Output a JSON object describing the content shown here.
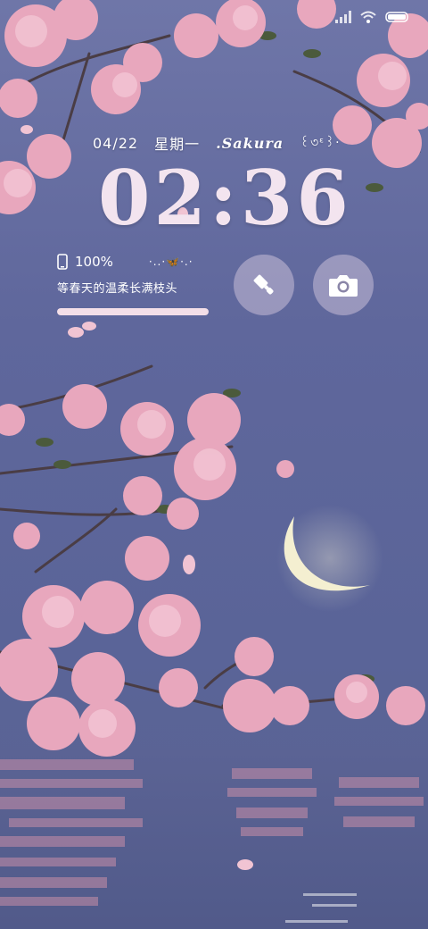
{
  "status_bar": {
    "icons": [
      "signal-icon",
      "wifi-icon",
      "battery-icon"
    ]
  },
  "lockscreen": {
    "date": "04/22",
    "weekday": "星期一",
    "brand": ".Sakura",
    "decoration": "꒰৩ᵋ꒱·",
    "time": "02:36",
    "battery_percent": "100%",
    "butterfly_deco": "·..·🦋·.·",
    "motto": "等春天的温柔长满枝头",
    "progress": 1.0
  },
  "shortcuts": {
    "left": "brush-icon",
    "right": "camera-icon"
  },
  "colors": {
    "sky_top": "#6f76a8",
    "sky_bottom": "#5a6290",
    "blossom": "#e8a7bd",
    "clock": "#f3e4ef"
  }
}
